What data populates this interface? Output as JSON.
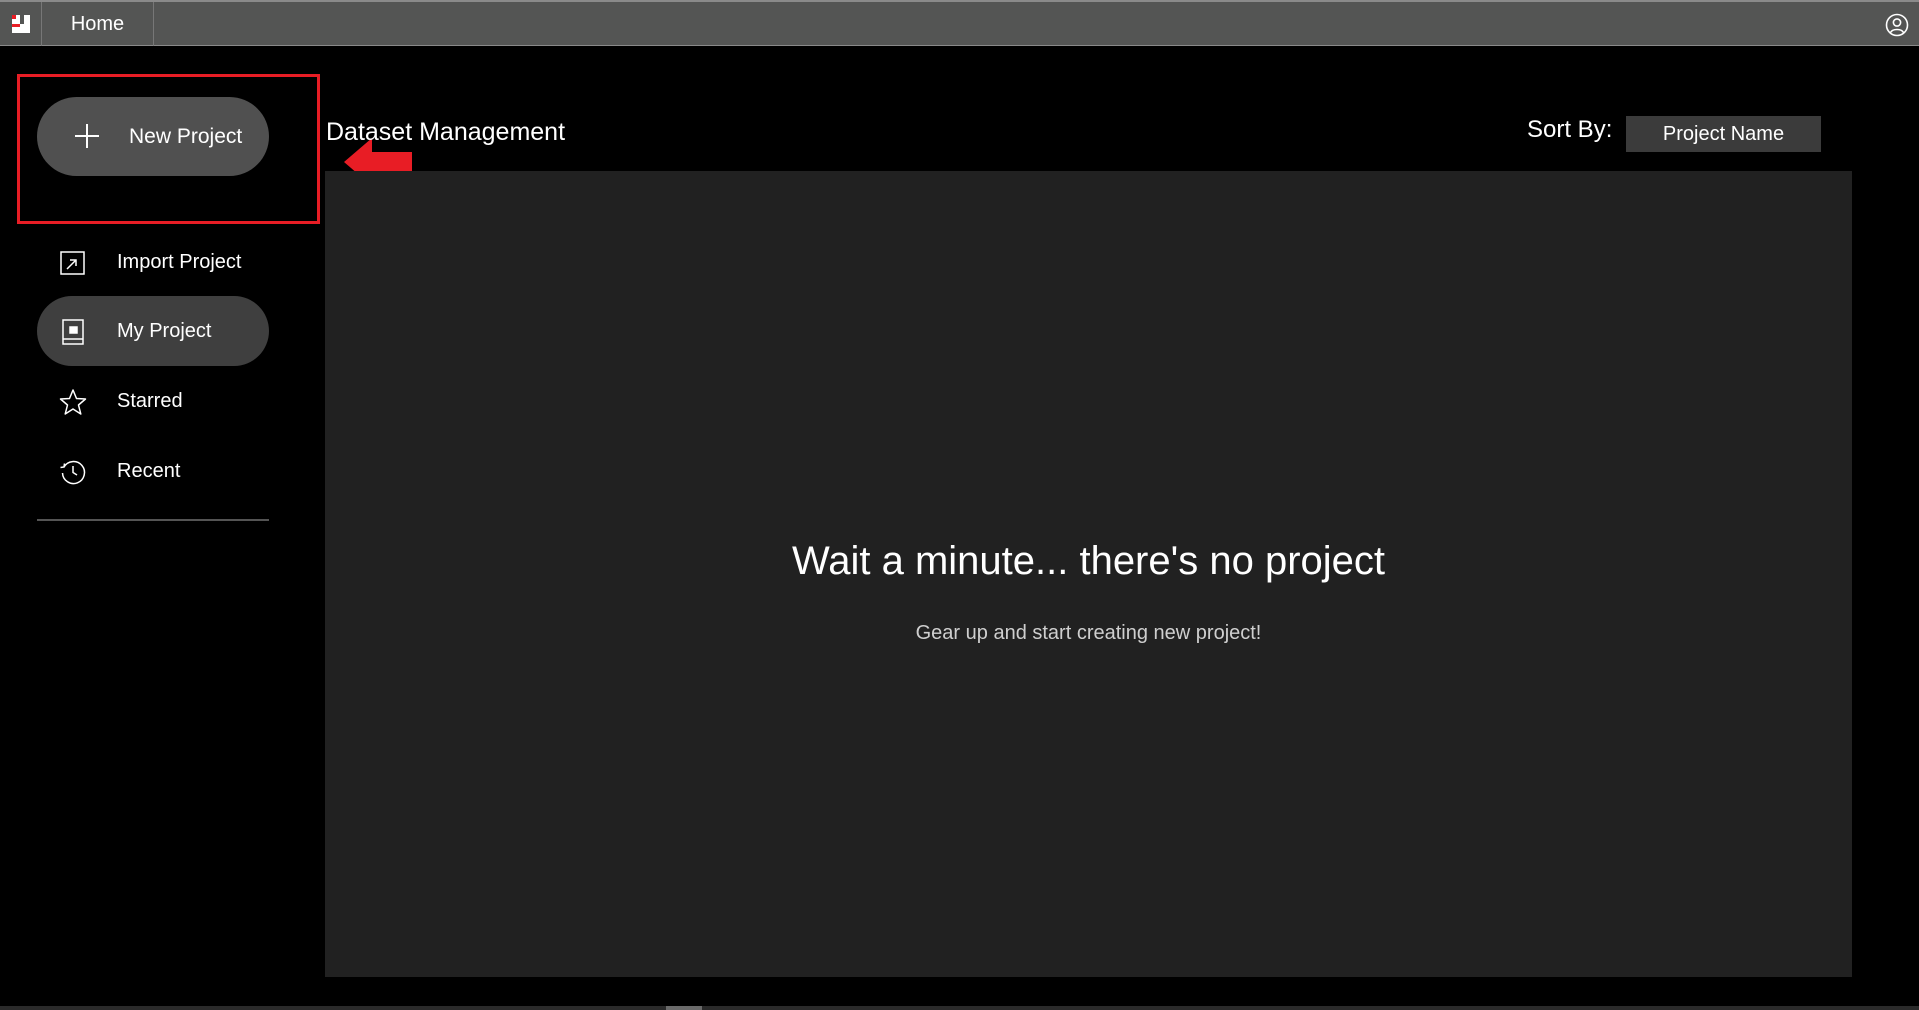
{
  "app": {
    "tab_home": "Home"
  },
  "sidebar": {
    "new_project": "New Project",
    "items": [
      {
        "label": "Import Project",
        "icon": "import-icon",
        "active": false
      },
      {
        "label": "My Project",
        "icon": "project-icon",
        "active": true
      },
      {
        "label": "Starred",
        "icon": "star-icon",
        "active": false
      },
      {
        "label": "Recent",
        "icon": "history-icon",
        "active": false
      }
    ]
  },
  "main": {
    "title": "Dataset Management",
    "sort_label": "Sort By:",
    "sort_value": "Project Name",
    "empty_title": "Wait a minute... there's no project",
    "empty_subtitle": "Gear up and start creating new project!"
  },
  "colors": {
    "topbar": "#545554",
    "panel": "#212121",
    "highlight": "#e81d25",
    "active_item": "#3f3f3f"
  }
}
